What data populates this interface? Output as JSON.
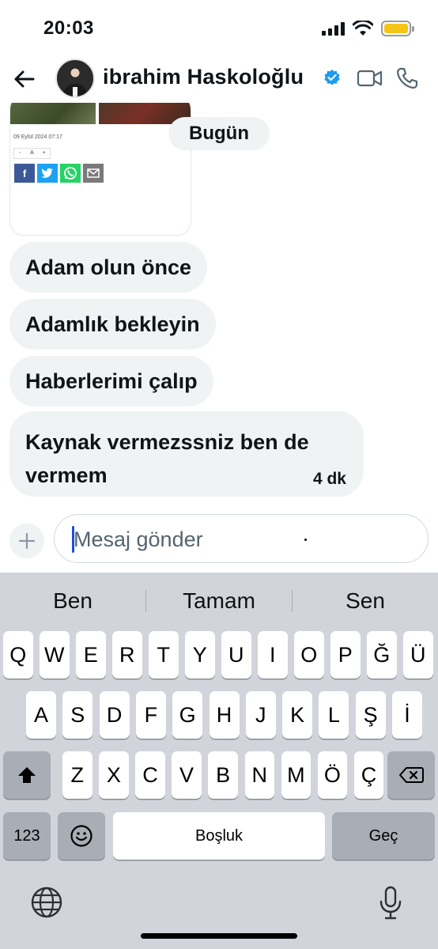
{
  "status_bar": {
    "time": "20:03"
  },
  "header": {
    "contact_name": "ibrahim Haskoloğlu",
    "verified": true,
    "icons": [
      "back-arrow-icon",
      "verified-badge-icon",
      "video-call-icon",
      "phone-icon"
    ]
  },
  "shared_card": {
    "date": "09 Eylül 2024 07:17",
    "font_controls": [
      "-",
      "A",
      "+"
    ],
    "share_buttons": [
      "facebook-icon",
      "twitter-icon",
      "whatsapp-icon",
      "email-icon"
    ]
  },
  "chat": {
    "date_label": "Bugün",
    "messages": [
      {
        "text": "Adam olun önce"
      },
      {
        "text": "Adamlık bekleyin"
      },
      {
        "text": "Haberlerimi çalıp"
      },
      {
        "text": "Kaynak vermezssniz ben de vermem",
        "time": "4 dk"
      }
    ]
  },
  "composer": {
    "placeholder": "Mesaj gönder"
  },
  "keyboard": {
    "suggestions": [
      "Ben",
      "Tamam",
      "Sen"
    ],
    "row1": [
      "Q",
      "W",
      "E",
      "R",
      "T",
      "Y",
      "U",
      "I",
      "O",
      "P",
      "Ğ",
      "Ü"
    ],
    "row2": [
      "A",
      "S",
      "D",
      "F",
      "G",
      "H",
      "J",
      "K",
      "L",
      "Ş",
      "İ"
    ],
    "row3": [
      "Z",
      "X",
      "C",
      "V",
      "B",
      "N",
      "M",
      "Ö",
      "Ç"
    ],
    "numbers_label": "123",
    "space_label": "Boşluk",
    "return_label": "Geç"
  },
  "colors": {
    "verified_blue": "#1d9bf0",
    "bubble_bg": "#eff3f4",
    "keyboard_bg": "#d1d4da",
    "battery_yellow": "#f5c518"
  }
}
